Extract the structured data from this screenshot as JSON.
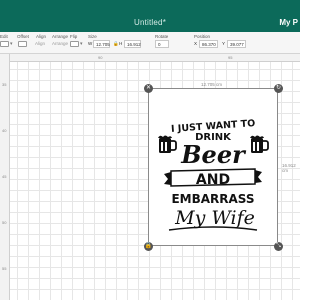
{
  "window": {
    "title": "Untitled*",
    "project_label": "My P"
  },
  "toolbar": {
    "edit_label": "Edit",
    "offset_label": "Offset",
    "align_label": "Align",
    "arrange_label": "Arrange",
    "flip_label": "Flip",
    "size_label": "Size",
    "rotate_label": "Rotate",
    "position_label": "Position",
    "width_prefix": "W",
    "width_value": "12.705",
    "height_prefix": "H",
    "height_value": "16.912",
    "rotate_value": "0",
    "x_prefix": "X",
    "x_value": "86.370",
    "y_prefix": "Y",
    "y_value": "39.077",
    "undo_label": "Undo",
    "redo_label": "Redo"
  },
  "ruler": {
    "top_numbers": [
      "90",
      "95"
    ],
    "left_numbers": [
      "35",
      "40",
      "45",
      "50",
      "55"
    ]
  },
  "selection": {
    "width_readout": "12.705 cm",
    "height_readout": "16.912 cm"
  },
  "design": {
    "line1": "I JUST WANT TO",
    "line2": "DRINK",
    "line3": "Beer",
    "line4": "AND",
    "line5": "EMBARRASS",
    "line6": "My Wife"
  },
  "colors": {
    "titlebar": "#0c6a5a",
    "ink": "#111111",
    "handle": "#555555"
  }
}
